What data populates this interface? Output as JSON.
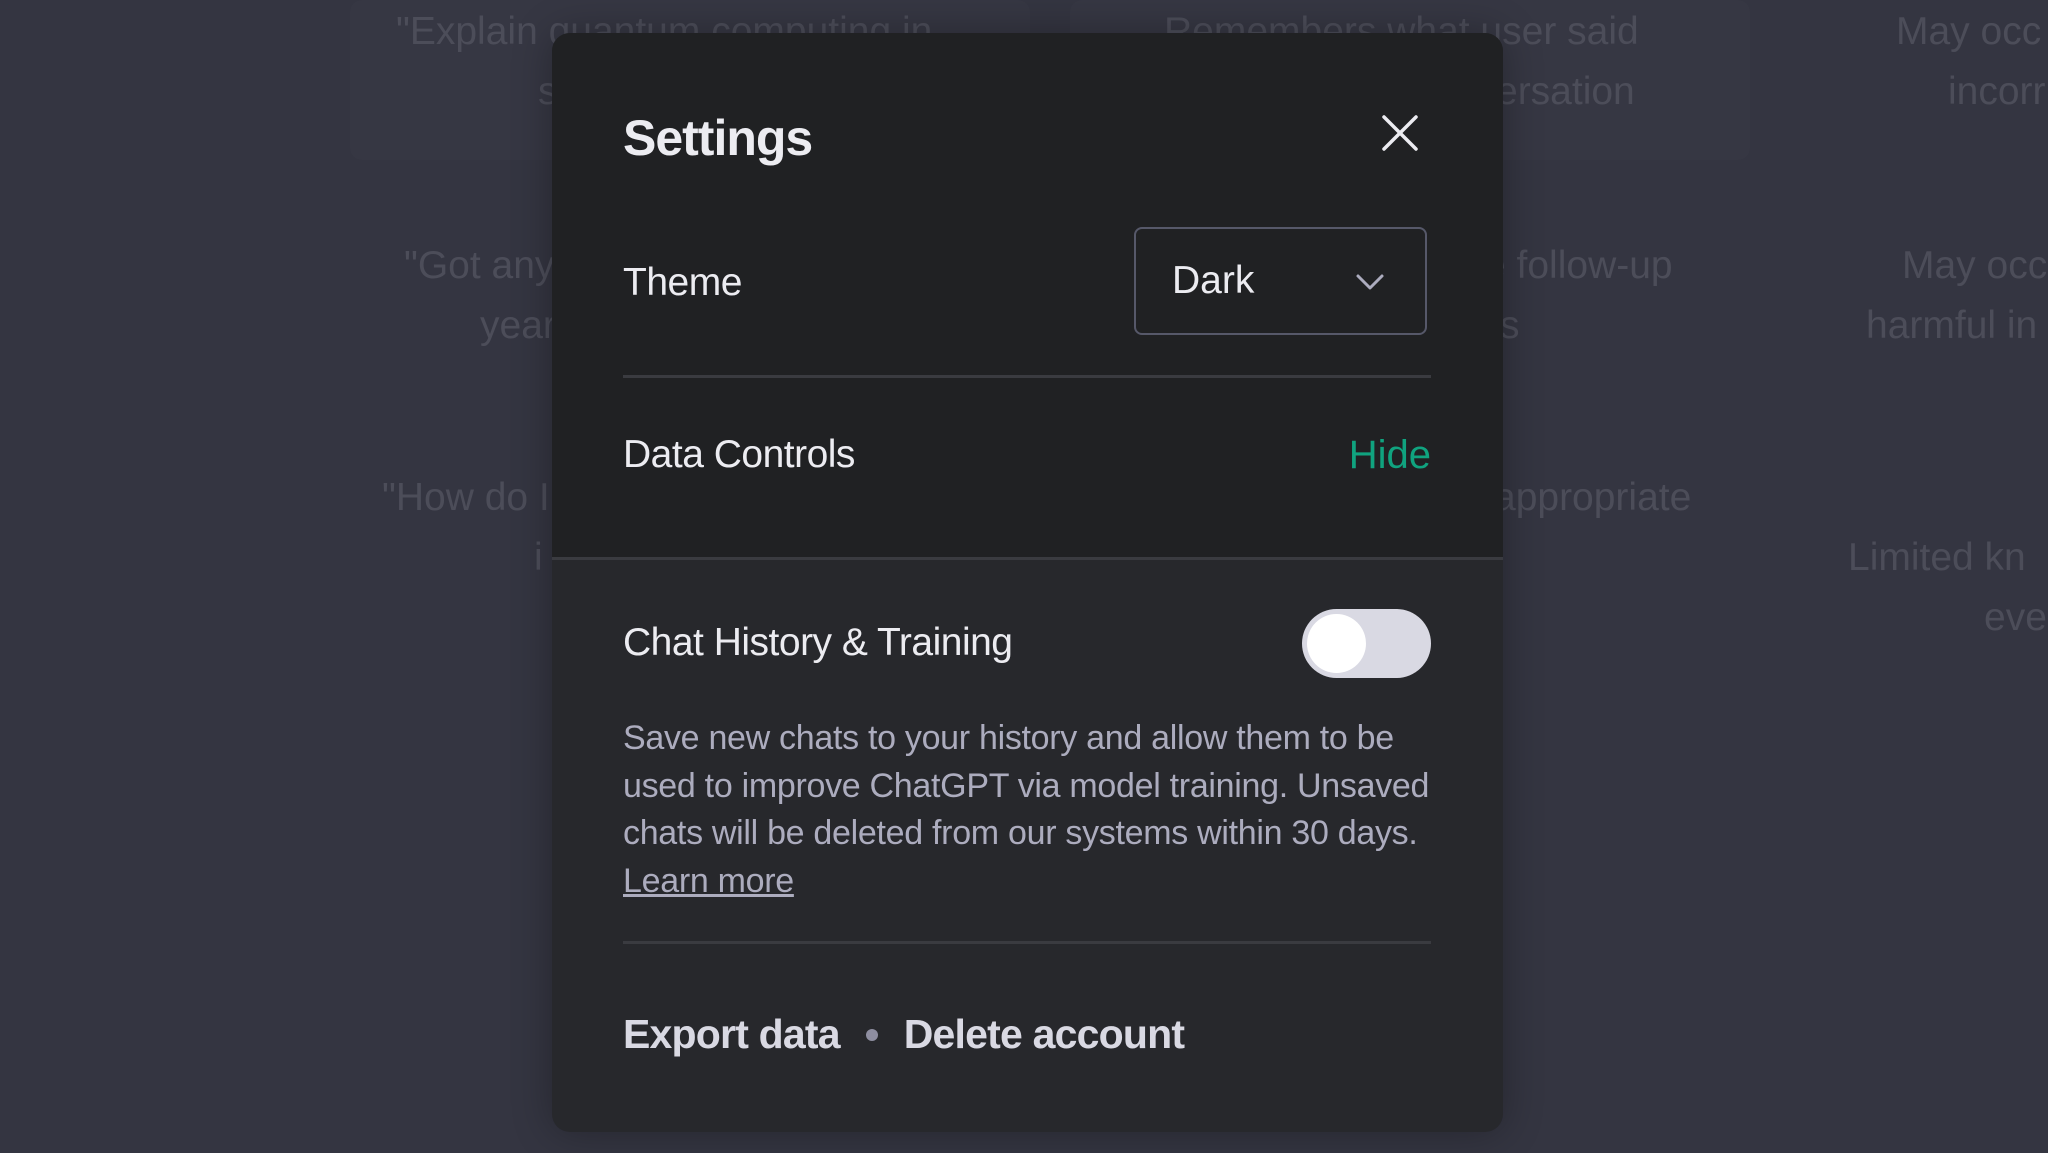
{
  "background": {
    "texts": [
      "\"Explain quantum computing in",
      "s",
      "Remembers what user said",
      "ersation",
      "May occ",
      "incorr",
      "\"Got any",
      "year",
      "e follow-up",
      "s",
      "May occ",
      "harmful in",
      "\"How do I",
      "i",
      "appropriate",
      "Limited kn",
      "eve"
    ]
  },
  "modal": {
    "title": "Settings",
    "close_icon": "close-icon",
    "theme": {
      "label": "Theme",
      "value": "Dark"
    },
    "data_controls": {
      "label": "Data Controls",
      "toggle_label": "Hide"
    },
    "chat_history": {
      "label": "Chat History & Training",
      "enabled": false,
      "description": "Save new chats to your history and allow them to be used to improve ChatGPT via model training. Unsaved chats will be deleted from our systems within 30 days.",
      "learn_more": "Learn more"
    },
    "footer": {
      "export": "Export data",
      "delete": "Delete account"
    }
  },
  "colors": {
    "accent": "#10a37f",
    "background": "#343541",
    "modal": "#202123"
  }
}
